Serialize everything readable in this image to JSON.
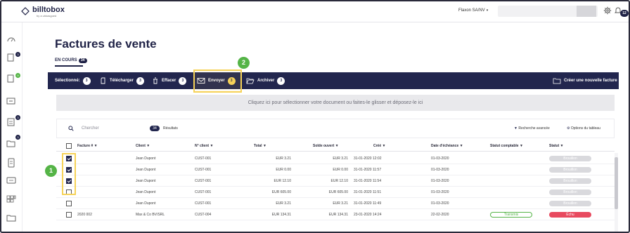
{
  "header": {
    "logo_text": "billtobox",
    "logo_sub": "by a uhkasgoed",
    "company": "Flaxon SA/NV",
    "company_arrow": "▾",
    "notifications_count": "12"
  },
  "sidebar": {
    "items": [
      {
        "icon": "dashboard-icon",
        "badge": ""
      },
      {
        "icon": "purchase-doc-icon",
        "badge": "3"
      },
      {
        "icon": "sales-doc-icon",
        "badge": "9"
      },
      {
        "icon": "bank-icon",
        "badge": ""
      },
      {
        "icon": "expense-icon",
        "badge": "3"
      },
      {
        "icon": "folder-check-icon",
        "badge": "3"
      },
      {
        "icon": "document-icon",
        "badge": ""
      },
      {
        "icon": "chat-icon",
        "badge": ""
      },
      {
        "icon": "grid-icon",
        "badge": ""
      },
      {
        "icon": "folder-icon",
        "badge": ""
      }
    ]
  },
  "page": {
    "title": "Factures de vente",
    "tab_label": "EN COURS",
    "tab_count": "34"
  },
  "actionbar": {
    "selected_label": "Sélectionné:",
    "selected_count": "3",
    "download_label": "Télécharger",
    "download_count": "3",
    "delete_label": "Effacer",
    "delete_count": "3",
    "send_label": "Envoyer",
    "send_count": "3",
    "archive_label": "Archiver",
    "archive_count": "3",
    "create_label": "Créer une nouvelle facture"
  },
  "steps": {
    "step1": "1",
    "step2": "2"
  },
  "dropzone": {
    "text": "Cliquez ici pour sélectionner votre document ou faites-le glisser et déposez-le ici"
  },
  "toolbar": {
    "search_placeholder": "Chercher",
    "results_count": "34",
    "results_label": "Résultats",
    "advanced_search": "Recherche avancée",
    "table_options": "Options du tableau"
  },
  "table": {
    "columns": [
      "Facture # ▼",
      "Client ▼",
      "N° client ▼",
      "Total ▼",
      "Solde ouvert ▼",
      "Créé ▼",
      "Date d'échéance ▼",
      "Statut comptable ▼",
      "Statut ▼"
    ],
    "rows": [
      {
        "checked": true,
        "invoice": "",
        "client": "Jean Dupont",
        "client_no": "CUST-001",
        "total": "EUR 3.21",
        "open": "EUR 3.21",
        "created": "31-01-2020 12:02",
        "due": "01-03-2020",
        "acc_status": "",
        "status": "Brouillon",
        "status_style": "grey"
      },
      {
        "checked": true,
        "invoice": "",
        "client": "Jean Dupont",
        "client_no": "CUST-001",
        "total": "EUR 0.00",
        "open": "EUR 0.00",
        "created": "31-01-2020 11:57",
        "due": "01-03-2020",
        "acc_status": "",
        "status": "Brouillon",
        "status_style": "grey"
      },
      {
        "checked": true,
        "invoice": "",
        "client": "Jean Dupont",
        "client_no": "CUST-001",
        "total": "EUR 12.10",
        "open": "EUR 12.10",
        "created": "31-01-2020 11:54",
        "due": "01-03-2020",
        "acc_status": "",
        "status": "Brouillon",
        "status_style": "grey"
      },
      {
        "checked": false,
        "invoice": "",
        "client": "Jean Dupont",
        "client_no": "CUST-001",
        "total": "EUR 605.00",
        "open": "EUR 605.00",
        "created": "31-01-2020 11:51",
        "due": "01-03-2020",
        "acc_status": "",
        "status": "Brouillon",
        "status_style": "grey"
      },
      {
        "checked": false,
        "invoice": "",
        "client": "Jean Dupont",
        "client_no": "CUST-001",
        "total": "EUR 3.21",
        "open": "EUR 3.21",
        "created": "31-01-2020 11:49",
        "due": "01-03-2020",
        "acc_status": "",
        "status": "Brouillon",
        "status_style": "grey"
      },
      {
        "checked": false,
        "invoice": "2020 002",
        "client": "Max & Co BV/SRL",
        "client_no": "CUST-004",
        "total": "EUR 134.31",
        "open": "EUR 134.31",
        "created": "23-01-2020 14:24",
        "due": "22-02-2020",
        "acc_status": "Transmis",
        "status": "Échu",
        "status_style": "red"
      }
    ]
  },
  "colors": {
    "navy": "#22264e",
    "highlight": "#f6d258",
    "green": "#55b447",
    "red": "#e84a5f"
  }
}
